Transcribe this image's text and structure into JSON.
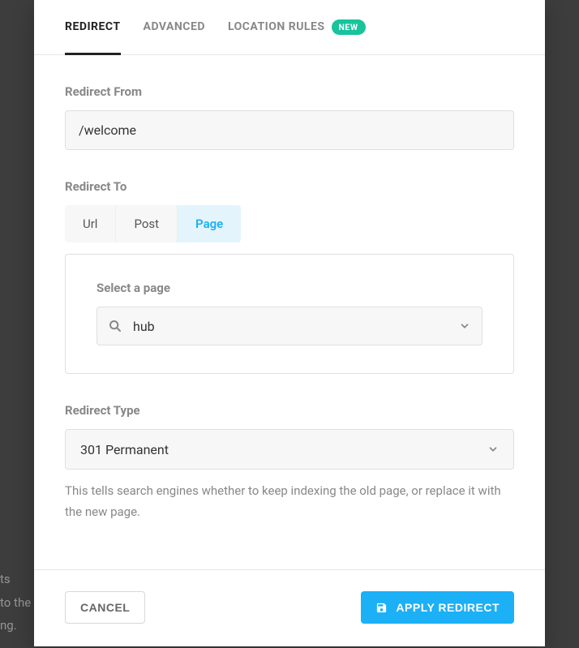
{
  "backdrop_lines": [
    "ts",
    "to the",
    "ng."
  ],
  "tabs": {
    "redirect": "REDIRECT",
    "advanced": "ADVANCED",
    "location_rules": "LOCATION RULES",
    "badge": "NEW"
  },
  "redirect_from": {
    "label": "Redirect From",
    "value": "/welcome"
  },
  "redirect_to": {
    "label": "Redirect To",
    "options": {
      "url": "Url",
      "post": "Post",
      "page": "Page"
    },
    "panel": {
      "label": "Select a page",
      "value": "hub"
    }
  },
  "redirect_type": {
    "label": "Redirect Type",
    "value": "301 Permanent",
    "helper": "This tells search engines whether to keep indexing the old page, or replace it with the new page."
  },
  "footer": {
    "cancel": "CANCEL",
    "apply": "APPLY REDIRECT"
  }
}
